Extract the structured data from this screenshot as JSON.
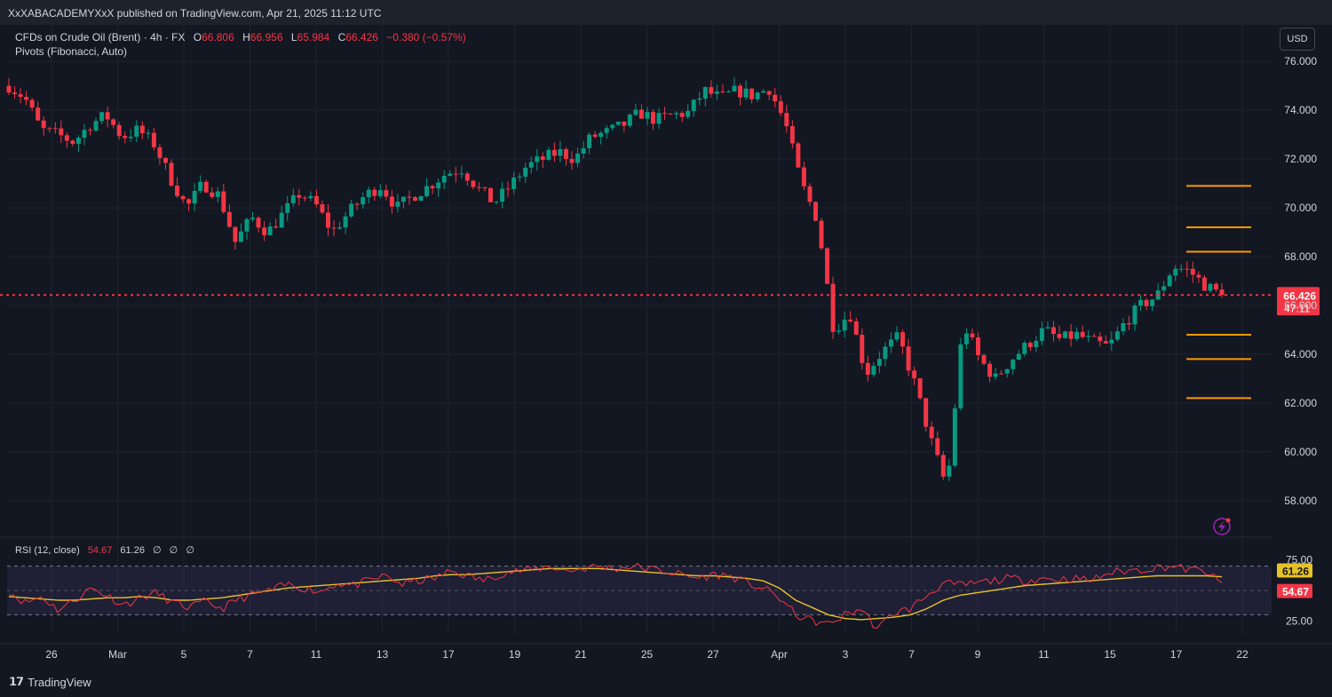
{
  "header": {
    "published": "XxXABACADEMYXxX published on TradingView.com, Apr 21, 2025 11:12 UTC"
  },
  "legend": {
    "symbol": "CFDs on Crude Oil (Brent) · 4h · FX",
    "open_label": "O",
    "open": "66.806",
    "high_label": "H",
    "high": "66.956",
    "low_label": "L",
    "low": "65.984",
    "close_label": "C",
    "close": "66.426",
    "change": "−0.380 (−0.57%)",
    "indicator": "Pivots (Fibonacci, Auto)"
  },
  "currency": "USD",
  "rsi_legend": {
    "name": "RSI (12, close)",
    "rsi_value": "54.67",
    "ma_value": "61.26",
    "extra": [
      "∅",
      "∅",
      "∅"
    ]
  },
  "brand": "TradingView",
  "colors": {
    "background": "#131722",
    "up": "#089981",
    "down": "#f23645",
    "pivot": "#ff9800",
    "rsi_line": "#f23645",
    "rsi_ma": "#e6c229",
    "rsi_band": "#7e57c2"
  },
  "chart_data": [
    {
      "type": "candlestick",
      "title": "CFDs on Crude Oil (Brent)",
      "timeframe": "4h",
      "currency": "USD",
      "ylim": [
        56.5,
        77.5
      ],
      "y_ticks": [
        "76.000",
        "74.000",
        "72.000",
        "70.000",
        "68.000",
        "66.000",
        "64.000",
        "62.000",
        "60.000",
        "58.000"
      ],
      "x_tick_labels": [
        "26",
        "Mar",
        "5",
        "7",
        "11",
        "13",
        "17",
        "19",
        "21",
        "25",
        "27",
        "Apr",
        "3",
        "7",
        "9",
        "11",
        "15",
        "17",
        "22"
      ],
      "last_price": "66.426",
      "countdown": "47:11",
      "pivot_levels": [
        70.9,
        69.2,
        68.2,
        64.8,
        63.8,
        62.2
      ],
      "anchors": [
        {
          "date": "Feb 24",
          "close": 75.0
        },
        {
          "date": "Feb 25",
          "close": 74.5
        },
        {
          "date": "Feb 25",
          "close": 73.2
        },
        {
          "date": "Feb 26",
          "close": 73.0
        },
        {
          "date": "Feb 27",
          "close": 72.7
        },
        {
          "date": "Feb 28",
          "close": 73.4
        },
        {
          "date": "Feb 28",
          "close": 73.8
        },
        {
          "date": "Mar 2",
          "close": 72.9
        },
        {
          "date": "Mar 3",
          "close": 73.2
        },
        {
          "date": "Mar 3",
          "close": 72.6
        },
        {
          "date": "Mar 4",
          "close": 71.2
        },
        {
          "date": "Mar 5",
          "close": 70.0
        },
        {
          "date": "Mar 5",
          "close": 71.0
        },
        {
          "date": "Mar 6",
          "close": 70.5
        },
        {
          "date": "Mar 6",
          "close": 68.6
        },
        {
          "date": "Mar 7",
          "close": 69.6
        },
        {
          "date": "Mar 7",
          "close": 69.0
        },
        {
          "date": "Mar 9",
          "close": 69.8
        },
        {
          "date": "Mar 10",
          "close": 70.6
        },
        {
          "date": "Mar 10",
          "close": 70.1
        },
        {
          "date": "Mar 11",
          "close": 69.0
        },
        {
          "date": "Mar 12",
          "close": 69.8
        },
        {
          "date": "Mar 13",
          "close": 70.5
        },
        {
          "date": "Mar 14",
          "close": 70.9
        },
        {
          "date": "Mar 14",
          "close": 70.0
        },
        {
          "date": "Mar 17",
          "close": 70.5
        },
        {
          "date": "Mar 17",
          "close": 70.9
        },
        {
          "date": "Mar 18",
          "close": 71.4
        },
        {
          "date": "Mar 19",
          "close": 71.6
        },
        {
          "date": "Mar 19",
          "close": 70.8
        },
        {
          "date": "Mar 20",
          "close": 70.2
        },
        {
          "date": "Mar 21",
          "close": 70.9
        },
        {
          "date": "Mar 21",
          "close": 71.7
        },
        {
          "date": "Mar 23",
          "close": 72.0
        },
        {
          "date": "Mar 24",
          "close": 72.3
        },
        {
          "date": "Mar 24",
          "close": 72.0
        },
        {
          "date": "Mar 25",
          "close": 72.9
        },
        {
          "date": "Mar 26",
          "close": 73.1
        },
        {
          "date": "Mar 26",
          "close": 73.4
        },
        {
          "date": "Mar 27",
          "close": 73.9
        },
        {
          "date": "Mar 27",
          "close": 73.6
        },
        {
          "date": "Mar 28",
          "close": 73.8
        },
        {
          "date": "Mar 30",
          "close": 73.9
        },
        {
          "date": "Mar 31",
          "close": 74.8
        },
        {
          "date": "Mar 31",
          "close": 74.5
        },
        {
          "date": "Apr 1",
          "close": 74.8
        },
        {
          "date": "Apr 2",
          "close": 74.6
        },
        {
          "date": "Apr 2",
          "close": 74.9
        },
        {
          "date": "Apr 3",
          "close": 73.5
        },
        {
          "date": "Apr 3",
          "close": 71.0
        },
        {
          "date": "Apr 4",
          "close": 69.5
        },
        {
          "date": "Apr 4",
          "close": 65.0
        },
        {
          "date": "Apr 6",
          "close": 65.7
        },
        {
          "date": "Apr 7",
          "close": 63.2
        },
        {
          "date": "Apr 7",
          "close": 64.1
        },
        {
          "date": "Apr 8",
          "close": 64.7
        },
        {
          "date": "Apr 8",
          "close": 62.8
        },
        {
          "date": "Apr 9",
          "close": 60.5
        },
        {
          "date": "Apr 9",
          "close": 58.5
        },
        {
          "date": "Apr 9",
          "close": 65.3
        },
        {
          "date": "Apr 10",
          "close": 63.8
        },
        {
          "date": "Apr 10",
          "close": 63.0
        },
        {
          "date": "Apr 11",
          "close": 63.8
        },
        {
          "date": "Apr 11",
          "close": 64.4
        },
        {
          "date": "Apr 14",
          "close": 65.0
        },
        {
          "date": "Apr 14",
          "close": 64.6
        },
        {
          "date": "Apr 15",
          "close": 64.8
        },
        {
          "date": "Apr 15",
          "close": 64.5
        },
        {
          "date": "Apr 16",
          "close": 64.3
        },
        {
          "date": "Apr 16",
          "close": 65.3
        },
        {
          "date": "Apr 17",
          "close": 66.0
        },
        {
          "date": "Apr 17",
          "close": 66.4
        },
        {
          "date": "Apr 18",
          "close": 67.6
        },
        {
          "date": "Apr 18",
          "close": 67.4
        },
        {
          "date": "Apr 20",
          "close": 66.8
        },
        {
          "date": "Apr 21",
          "close": 66.426
        }
      ]
    },
    {
      "type": "line",
      "title": "RSI (12, close)",
      "ylim": [
        15,
        85
      ],
      "y_ticks": [
        "75.00",
        "25.00"
      ],
      "bands": [
        70,
        50,
        30
      ],
      "rsi_last": "54.67",
      "ma_last": "61.26",
      "rsi_anchors": [
        49,
        40,
        45,
        34,
        42,
        52,
        46,
        38,
        44,
        48,
        40,
        36,
        41,
        35,
        43,
        47,
        50,
        55,
        52,
        49,
        56,
        54,
        58,
        62,
        55,
        58,
        60,
        66,
        62,
        58,
        64,
        66,
        67,
        70,
        66,
        68,
        70,
        68,
        70,
        68,
        66,
        63,
        60,
        63,
        62,
        56,
        52,
        44,
        30,
        25,
        22,
        30,
        35,
        18,
        32,
        35,
        46,
        56,
        54,
        56,
        58,
        60,
        58,
        60,
        59,
        60,
        58,
        64,
        66,
        67,
        69,
        70,
        67,
        66,
        54.67
      ],
      "ma_anchors": [
        45,
        44,
        43,
        42,
        42,
        43,
        44,
        44,
        45,
        44,
        42,
        42,
        43,
        44,
        46,
        48,
        50,
        52,
        53,
        54,
        55,
        56,
        57,
        58,
        59,
        60,
        62,
        63,
        63,
        64,
        65,
        66,
        67,
        68,
        68,
        68,
        68,
        67,
        66,
        65,
        64,
        63,
        62,
        62,
        61,
        60,
        58,
        52,
        42,
        36,
        30,
        27,
        26,
        27,
        28,
        30,
        35,
        42,
        46,
        48,
        50,
        52,
        54,
        55,
        56,
        57,
        58,
        59,
        60,
        61,
        62,
        62,
        62,
        62,
        61.26
      ]
    }
  ]
}
